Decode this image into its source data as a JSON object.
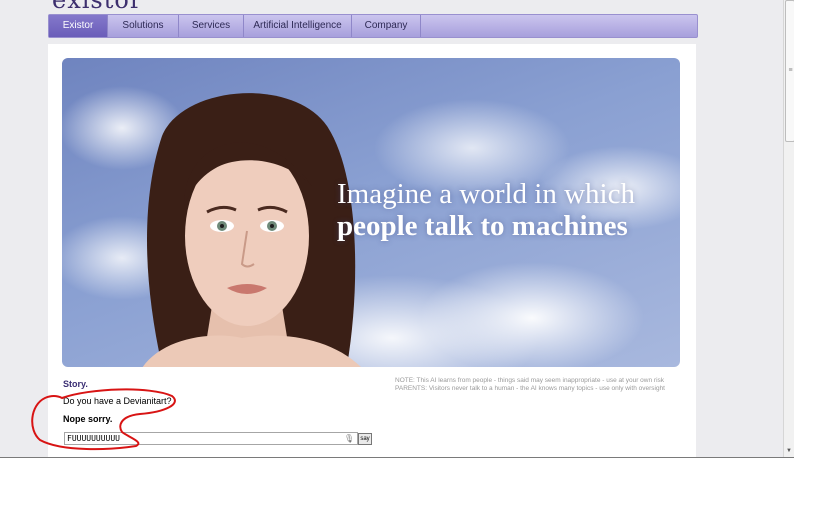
{
  "site": {
    "logo_text": "existor"
  },
  "nav": {
    "items": [
      {
        "label": "Existor",
        "active": true
      },
      {
        "label": "Solutions",
        "active": false
      },
      {
        "label": "Services",
        "active": false
      },
      {
        "label": "Artificial Intelligence",
        "active": false
      },
      {
        "label": "Company",
        "active": false
      }
    ]
  },
  "hero": {
    "headline_line1": "Imagine a world in which",
    "headline_line2": "people talk to machines"
  },
  "chat": {
    "story_label": "Story.",
    "user_message": "Do you have a Devianitart?",
    "bot_reply": "Nope sorry.",
    "input_value": "FUUUUUUUUUU",
    "say_button_label": "say"
  },
  "notes": {
    "line1": "NOTE: This AI learns from people - things said may seem inappropriate - use at your own risk",
    "line2": "PARENTS: Visitors never talk to a human - the AI knows many topics - use only with oversight"
  },
  "colors": {
    "nav_active": "#6a5db9",
    "nav_bar": "#b3abe3",
    "annotation_red": "#d81414",
    "logo": "#3d2f6e"
  },
  "icons": {
    "mic": "microphone-icon",
    "scroll_down": "scroll-down-arrow-icon"
  }
}
